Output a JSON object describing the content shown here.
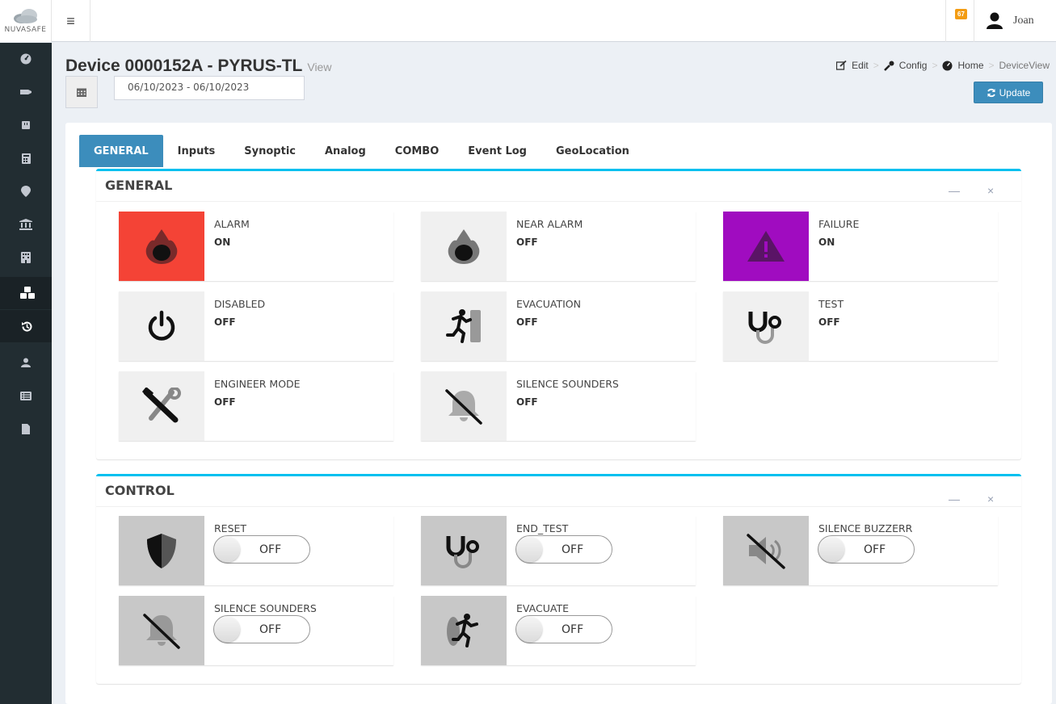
{
  "header": {
    "logo_text": "NUVASAFE",
    "menu_icon": "hamburger-icon",
    "notification_count": "67",
    "user_name": "Joan"
  },
  "sidebar": {
    "items": [
      {
        "icon": "dashboard-icon"
      },
      {
        "icon": "hand-point-icon"
      },
      {
        "icon": "sim-card-icon"
      },
      {
        "icon": "calculator-icon"
      },
      {
        "icon": "map-marker-icon"
      },
      {
        "icon": "institution-icon"
      },
      {
        "icon": "building-icon"
      },
      {
        "icon": "cubes-icon",
        "active": true
      },
      {
        "icon": "history-icon",
        "active": true
      },
      {
        "icon": "user-icon"
      },
      {
        "icon": "list-icon"
      },
      {
        "icon": "file-icon"
      }
    ]
  },
  "page": {
    "title": "Device 0000152A - PYRUS-TL",
    "subtitle": "View",
    "date_range": "06/10/2023 - 06/10/2023",
    "update_label": "Update"
  },
  "breadcrumb": {
    "edit": "Edit",
    "config": "Config",
    "home": "Home",
    "current": "DeviceView",
    "separator": ">"
  },
  "tabs": [
    "GENERAL",
    "Inputs",
    "Synoptic",
    "Analog",
    "COMBO",
    "Event Log",
    "GeoLocation"
  ],
  "general_box": {
    "title": "GENERAL",
    "minimize": "—",
    "close": "×",
    "cards": [
      {
        "label": "ALARM",
        "value": "ON",
        "icon": "fire-icon",
        "bg": "#f44336"
      },
      {
        "label": "NEAR ALARM",
        "value": "OFF",
        "icon": "fire-icon",
        "bg": "#f0f0f0"
      },
      {
        "label": "FAILURE",
        "value": "ON",
        "icon": "warning-icon",
        "bg": "#a00cc0"
      },
      {
        "label": "DISABLED",
        "value": "OFF",
        "icon": "power-icon",
        "bg": "#f0f0f0"
      },
      {
        "label": "EVACUATION",
        "value": "OFF",
        "icon": "exit-run-icon",
        "bg": "#f0f0f0"
      },
      {
        "label": "TEST",
        "value": "OFF",
        "icon": "stethoscope-icon",
        "bg": "#f0f0f0"
      },
      {
        "label": "ENGINEER MODE",
        "value": "OFF",
        "icon": "tools-icon",
        "bg": "#f0f0f0"
      },
      {
        "label": "SILENCE SOUNDERS",
        "value": "OFF",
        "icon": "bell-slash-icon",
        "bg": "#f0f0f0"
      }
    ]
  },
  "control_box": {
    "title": "CONTROL",
    "minimize": "—",
    "close": "×",
    "cards": [
      {
        "label": "RESET",
        "state": "OFF",
        "icon": "shield-icon"
      },
      {
        "label": "END_TEST",
        "state": "OFF",
        "icon": "stethoscope-icon"
      },
      {
        "label": "SILENCE BUZZERR",
        "state": "OFF",
        "icon": "volume-mute-icon"
      },
      {
        "label": "SILENCE SOUNDERS",
        "state": "OFF",
        "icon": "bell-slash-icon"
      },
      {
        "label": "EVACUATE",
        "state": "OFF",
        "icon": "exit-run-icon"
      }
    ]
  }
}
